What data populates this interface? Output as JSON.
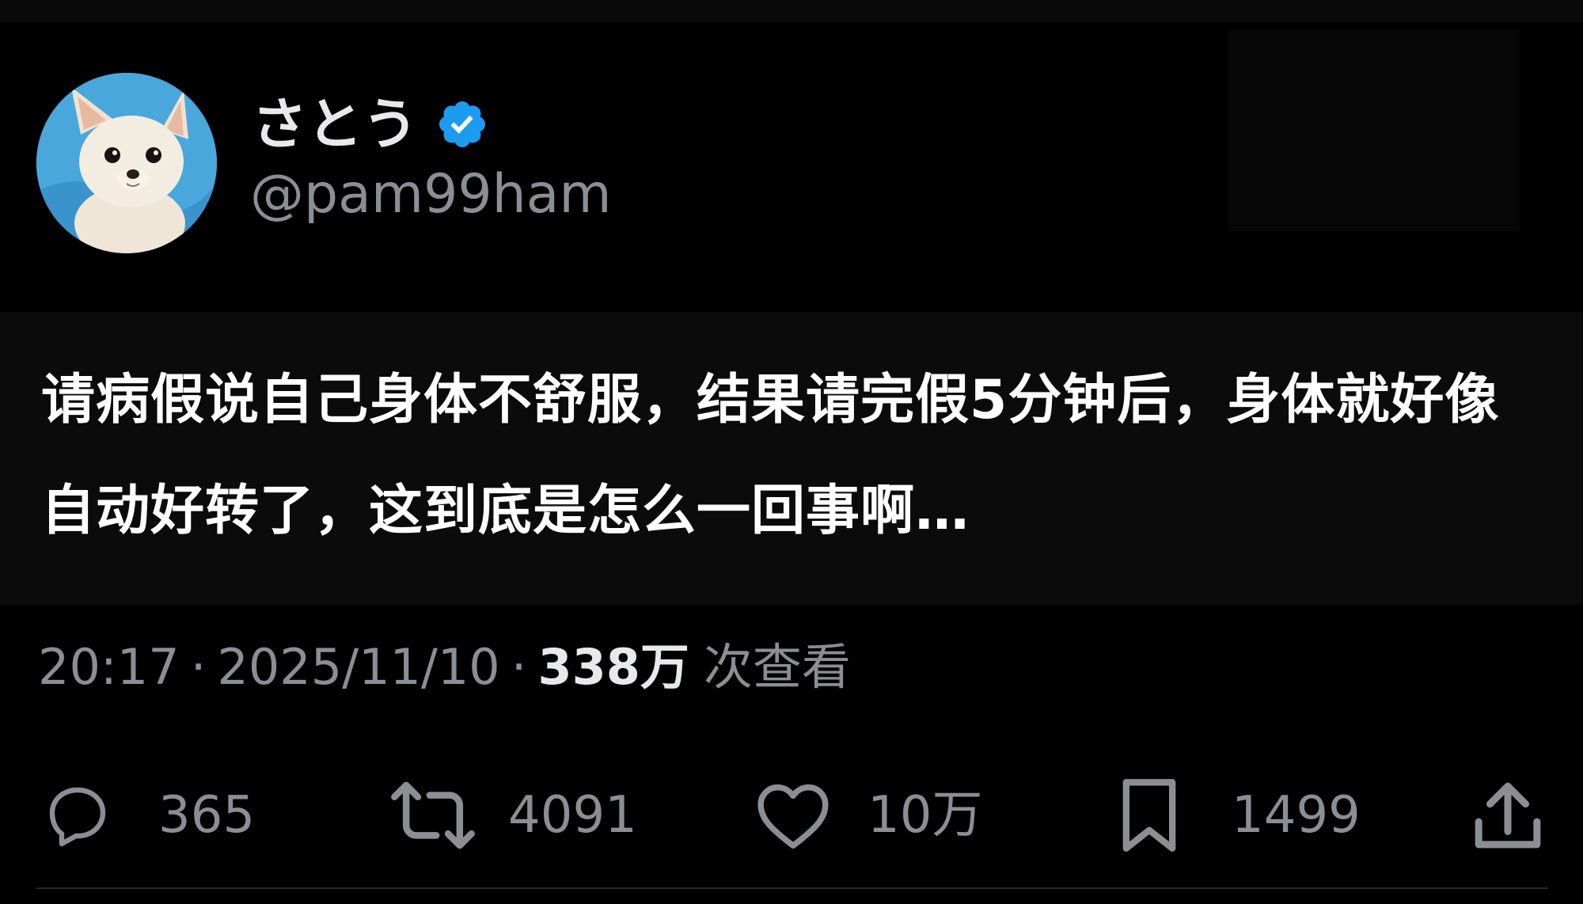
{
  "author": {
    "display_name": "さとう",
    "handle": "@pam99ham",
    "verified": true,
    "avatar_icon": "chihuahua-avatar",
    "verified_icon": "verified-badge-icon"
  },
  "tweet": {
    "text": "请病假说自己身体不舒服，结果请完假5分钟后，身体就好像自动好转了，这到底是怎么一回事啊…"
  },
  "meta": {
    "time": "20:17",
    "separator": "·",
    "date": "2025/11/10",
    "views_count": "338万",
    "views_label": "次查看"
  },
  "actions": {
    "reply": {
      "icon": "reply-icon",
      "count": "365"
    },
    "retweet": {
      "icon": "retweet-icon",
      "count": "4091"
    },
    "like": {
      "icon": "heart-icon",
      "count": "10万"
    },
    "bookmark": {
      "icon": "bookmark-icon",
      "count": "1499"
    },
    "share": {
      "icon": "share-icon"
    }
  },
  "colors": {
    "background": "#000000",
    "text_primary": "#e7e9ea",
    "text_secondary": "#8b8f93",
    "verified_blue": "#1d9bf0"
  }
}
